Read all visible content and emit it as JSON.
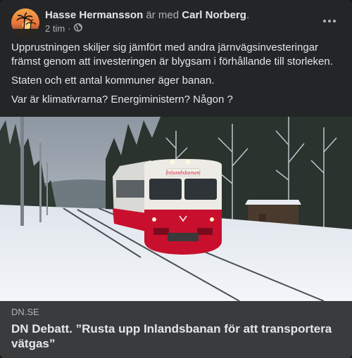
{
  "post": {
    "author": "Hasse Hermansson",
    "with_text": " är med ",
    "tagged": "Carl Norberg",
    "tagged_suffix": ".",
    "time": "2 tim",
    "separator": "·",
    "privacy_icon": "globe-icon",
    "more_icon": "more-horizontal-icon",
    "paragraphs": [
      "Upprustningen skiljer sig jämfört med andra järnvägsinvesteringar främst genom att investeringen är blygsam i förhållande till storleken.",
      "Staten och ett antal kommuner äger banan.",
      "Var är klimativrarna? Energiministern? Någon ?"
    ]
  },
  "link_preview": {
    "image": "red-white-train-in-snow",
    "train_sign": "Inlandsbanan",
    "domain": "DN.SE",
    "title": "DN Debatt. ”Rusta upp Inlandsbanan för att transportera vätgas”"
  },
  "colors": {
    "card_bg": "#242526",
    "text_primary": "#e4e6eb",
    "text_secondary": "#b0b3b8",
    "link_info_bg": "#3a3b3c",
    "train_red": "#c8102e"
  }
}
